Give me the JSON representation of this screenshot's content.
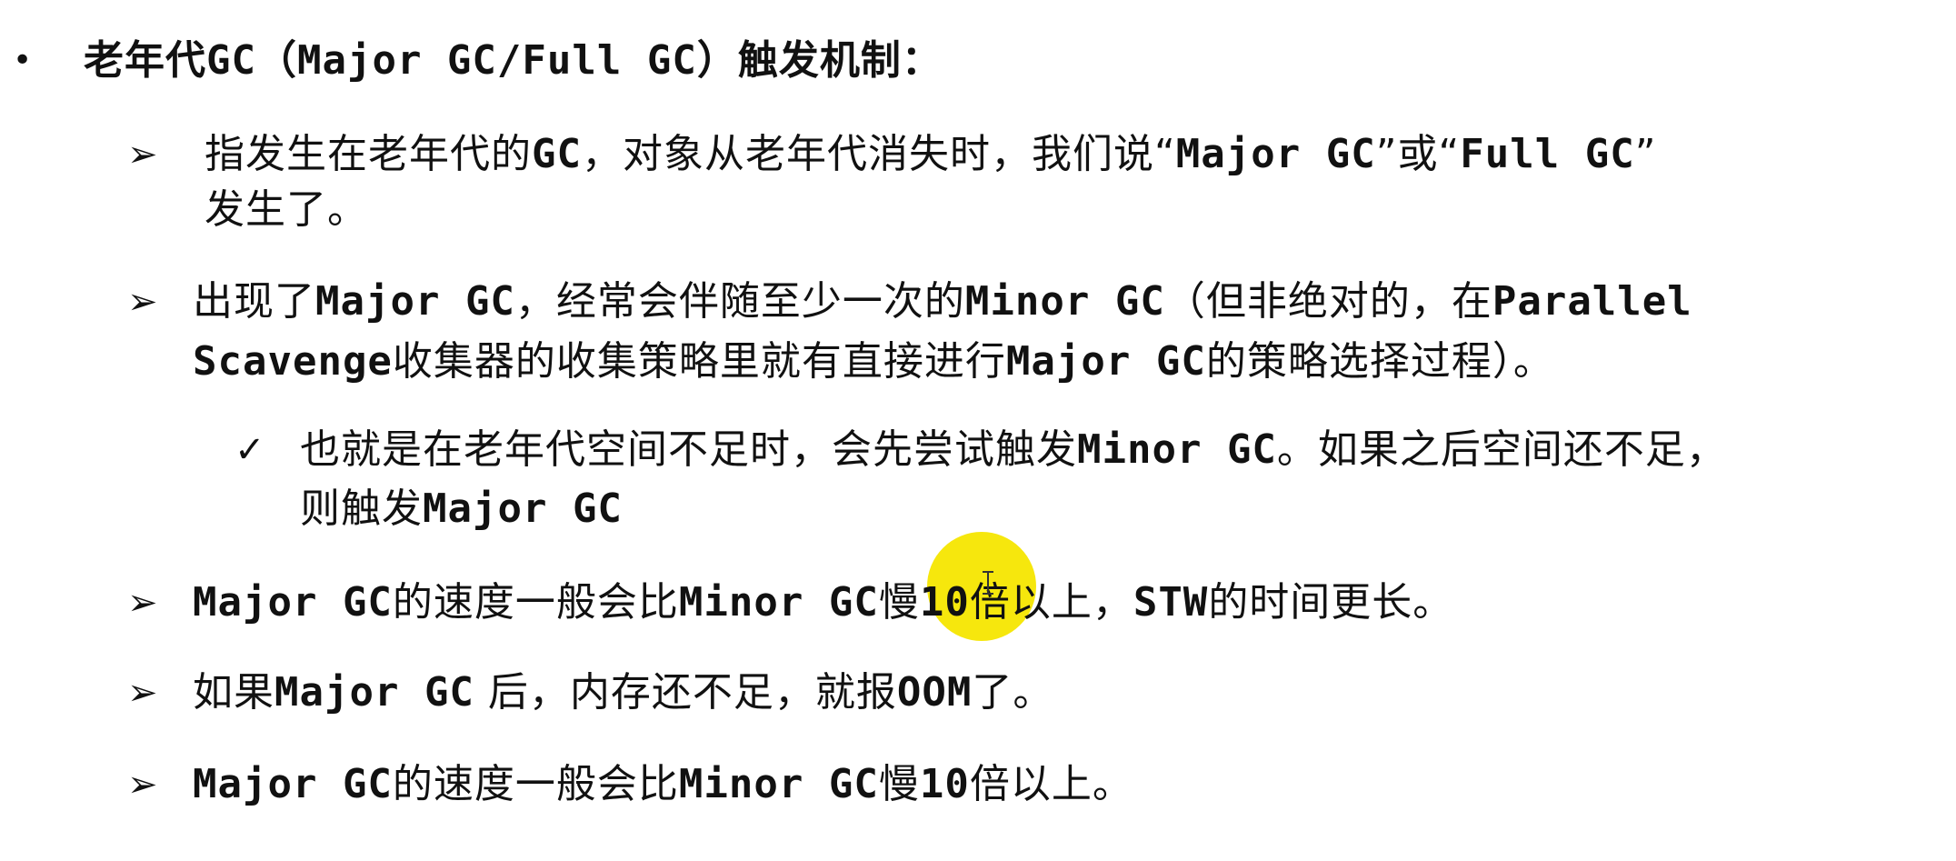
{
  "heading": {
    "prefix": "老年代",
    "mono": "GC（Major GC/Full GC）",
    "suffix": "触发机制："
  },
  "items": [
    {
      "l1a": "指发生在老年代的",
      "l1b": "GC",
      "l1c": "，对象从老年代消失时，我们说“",
      "l1d": "Major GC",
      "l1e": "”或“",
      "l1f": "Full GC",
      "l1g": "”",
      "l2": "发生了。"
    },
    {
      "l1a": "出现了",
      "l1b": "Major GC",
      "l1c": "，经常会伴随至少一次的",
      "l1d": "Minor GC",
      "l1e": "（但非绝对的，在",
      "l1f": "Parallel",
      "l2a": "Scavenge",
      "l2b": "收集器的收集策略里就有直接进行",
      "l2c": "Major GC",
      "l2d": "的策略选择过程）。"
    },
    {
      "l1a": "也就是在老年代空间不足时，会先尝试触发",
      "l1b": "Minor GC",
      "l1c": "。如果之后空间还不足，",
      "l2a": "则触发",
      "l2b": "Major GC"
    },
    {
      "a": "Major GC",
      "b": "的速度一般会比",
      "c": "Minor GC",
      "d": "慢",
      "e": "10",
      "f": "倍以上，",
      "g": "STW",
      "h": "的时间更长。"
    },
    {
      "a": "如果",
      "b": "Major GC",
      "c": " 后，内存还不足，就报",
      "d": "OOM",
      "e": "了。"
    },
    {
      "a": "Major GC",
      "b": "的速度一般会比",
      "c": "Minor GC",
      "d": "慢",
      "e": "10",
      "f": "倍以上。"
    }
  ],
  "icons": {
    "bullet": "•",
    "arrow": "➢",
    "check": "✓"
  }
}
